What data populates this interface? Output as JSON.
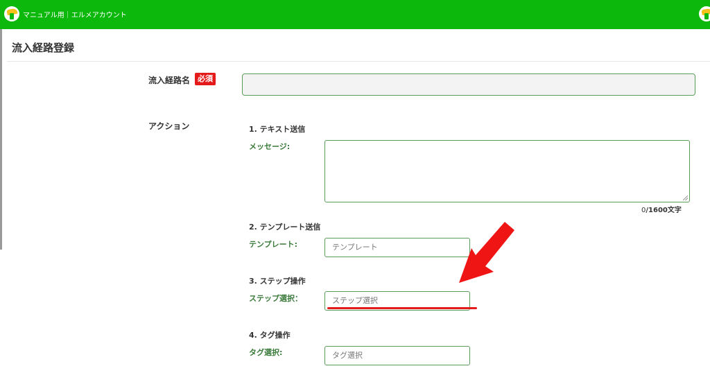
{
  "header": {
    "brand": "マニュアル用｜エルメアカウント",
    "colors": {
      "bar": "#0bb80b",
      "accent_red": "#e51b1b"
    }
  },
  "page": {
    "title": "流入経路登録"
  },
  "form": {
    "route_name_label": "流入経路名",
    "required_badge": "必須",
    "route_name_value": "",
    "action_label": "アクション",
    "sections": {
      "text": {
        "title": "1. テキスト送信",
        "label": "メッセージ:",
        "value": "",
        "counter_current": "0",
        "counter_max": "/1600文字"
      },
      "template": {
        "title": "2. テンプレート送信",
        "label": "テンプレート:",
        "placeholder": "テンプレート"
      },
      "step": {
        "title": "3. ステップ操作",
        "label": "ステップ選択：",
        "placeholder": "ステップ選択"
      },
      "tag": {
        "title": "4. タグ操作",
        "label": "タグ選択:",
        "placeholder": "タグ選択"
      }
    }
  },
  "annotation": {
    "arrow_icon": "red-arrow-icon",
    "underline": "red-underline"
  }
}
